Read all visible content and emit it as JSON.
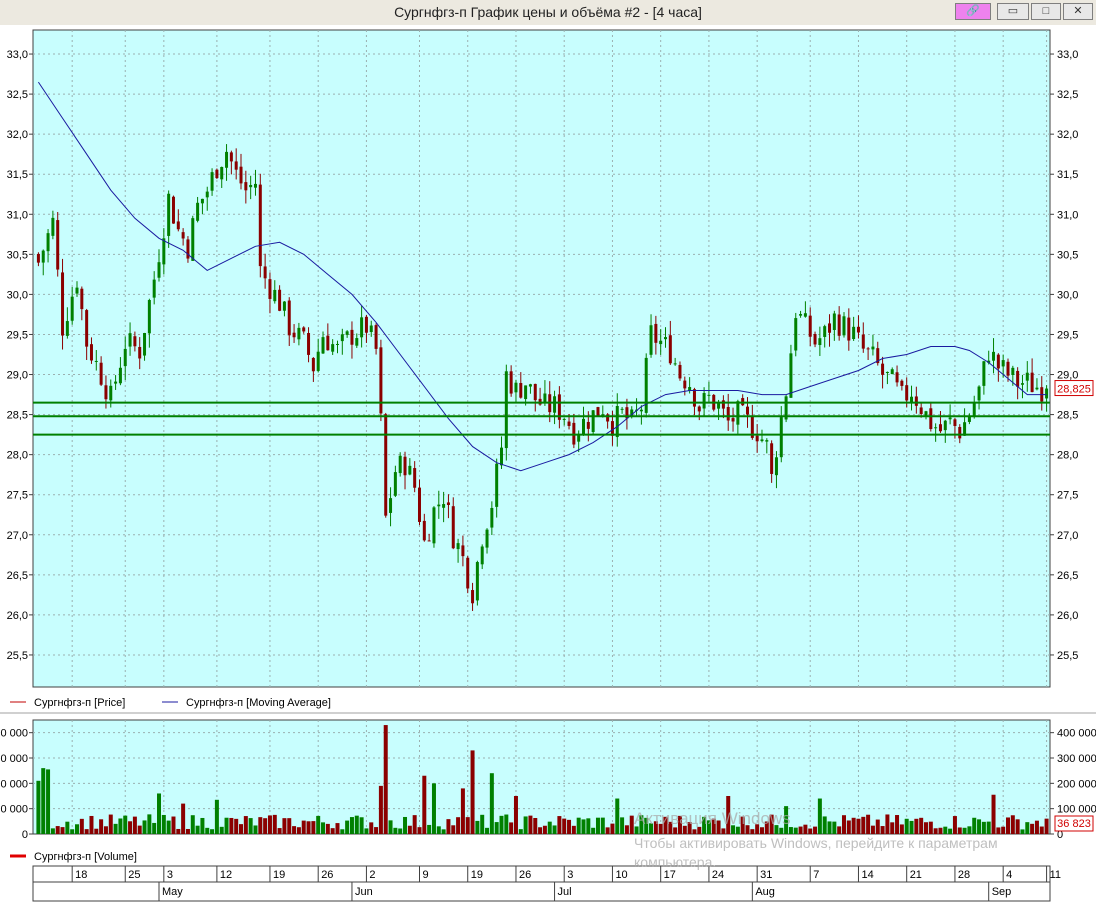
{
  "window": {
    "title": "Сургнфгз-п График цены и объёма #2 - [4 часа]",
    "buttons": {
      "link": "🔗",
      "minimize": "▭",
      "maximize": "□",
      "close": "✕"
    }
  },
  "colors": {
    "plot_bg": "#c8fefe",
    "up": "#008000",
    "down": "#8b0000",
    "ma": "#1a1aa0",
    "level": "#008000",
    "grid": "#9bb0b0",
    "price_label": "#d00000"
  },
  "legend": {
    "price": "Сургнфгз-п [Price]",
    "ma": "Сургнфгз-п [Moving Average]",
    "volume": "Сургнфгз-п [Volume]"
  },
  "last_price_label": "28,825",
  "last_volume_label": "36 823",
  "watermark": {
    "line1": "Активация Windows",
    "line2": "Чтобы активировать Windows, перейдите к параметрам компьютера."
  },
  "chart_data": [
    {
      "type": "candlestick",
      "ylim": [
        25.1,
        33.3
      ],
      "y_ticks": [
        "33,0",
        "32,5",
        "32,0",
        "31,5",
        "31,0",
        "30,5",
        "30,0",
        "29,5",
        "29,0",
        "28,5",
        "28,0",
        "27,5",
        "27,0",
        "26,5",
        "26,0",
        "25,5"
      ],
      "y_tick_values": [
        33.0,
        32.5,
        32.0,
        31.5,
        31.0,
        30.5,
        30.0,
        29.5,
        29.0,
        28.5,
        28.0,
        27.5,
        27.0,
        26.5,
        26.0,
        25.5
      ],
      "grid": true,
      "horizontal_levels": [
        28.65,
        28.48,
        28.25
      ],
      "last_price": 28.825,
      "price_anchors": [
        [
          0,
          30.4
        ],
        [
          3,
          30.9
        ],
        [
          5,
          29.6
        ],
        [
          8,
          30.2
        ],
        [
          10,
          29.4
        ],
        [
          13,
          29.0
        ],
        [
          15,
          28.7
        ],
        [
          18,
          29.4
        ],
        [
          21,
          29.3
        ],
        [
          24,
          30.2
        ],
        [
          27,
          31.2
        ],
        [
          29,
          30.8
        ],
        [
          31,
          30.6
        ],
        [
          33,
          31.1
        ],
        [
          35,
          31.3
        ],
        [
          37,
          31.6
        ],
        [
          39,
          31.8
        ],
        [
          41,
          31.5
        ],
        [
          43,
          31.3
        ],
        [
          45,
          31.4
        ],
        [
          46,
          30.3
        ],
        [
          48,
          30.1
        ],
        [
          50,
          29.9
        ],
        [
          52,
          29.6
        ],
        [
          55,
          29.4
        ],
        [
          57,
          29.1
        ],
        [
          59,
          29.5
        ],
        [
          62,
          29.3
        ],
        [
          65,
          29.5
        ],
        [
          68,
          29.6
        ],
        [
          70,
          29.3
        ],
        [
          71,
          28.4
        ],
        [
          72,
          27.2
        ],
        [
          74,
          27.8
        ],
        [
          76,
          27.9
        ],
        [
          78,
          27.6
        ],
        [
          80,
          26.9
        ],
        [
          82,
          27.3
        ],
        [
          84,
          27.5
        ],
        [
          86,
          27.0
        ],
        [
          88,
          26.7
        ],
        [
          90,
          26.3
        ],
        [
          92,
          27.0
        ],
        [
          94,
          27.4
        ],
        [
          96,
          28.1
        ],
        [
          97,
          29.0
        ],
        [
          99,
          28.8
        ],
        [
          101,
          28.9
        ],
        [
          103,
          28.7
        ],
        [
          105,
          28.6
        ],
        [
          107,
          28.6
        ],
        [
          109,
          28.5
        ],
        [
          111,
          28.3
        ],
        [
          113,
          28.4
        ],
        [
          115,
          28.5
        ],
        [
          117,
          28.6
        ],
        [
          119,
          28.4
        ],
        [
          121,
          28.5
        ],
        [
          123,
          28.4
        ],
        [
          125,
          28.6
        ],
        [
          127,
          29.5
        ],
        [
          129,
          29.4
        ],
        [
          131,
          29.3
        ],
        [
          133,
          29.0
        ],
        [
          135,
          28.9
        ],
        [
          137,
          28.6
        ],
        [
          139,
          28.7
        ],
        [
          141,
          28.6
        ],
        [
          143,
          28.4
        ],
        [
          145,
          28.5
        ],
        [
          147,
          28.4
        ],
        [
          149,
          28.3
        ],
        [
          151,
          28.1
        ],
        [
          152,
          27.7
        ],
        [
          153,
          28.1
        ],
        [
          155,
          28.8
        ],
        [
          157,
          29.8
        ],
        [
          159,
          29.6
        ],
        [
          161,
          29.4
        ],
        [
          163,
          29.5
        ],
        [
          165,
          29.7
        ],
        [
          167,
          29.6
        ],
        [
          169,
          29.5
        ],
        [
          171,
          29.3
        ],
        [
          173,
          29.2
        ],
        [
          175,
          29.0
        ],
        [
          177,
          28.9
        ],
        [
          179,
          28.7
        ],
        [
          181,
          28.8
        ],
        [
          183,
          28.6
        ],
        [
          185,
          28.4
        ],
        [
          187,
          28.3
        ],
        [
          189,
          28.4
        ],
        [
          191,
          28.3
        ],
        [
          193,
          28.5
        ],
        [
          195,
          28.8
        ],
        [
          197,
          29.3
        ],
        [
          199,
          29.1
        ],
        [
          201,
          29.0
        ],
        [
          203,
          28.9
        ],
        [
          205,
          28.9
        ],
        [
          207,
          28.85
        ],
        [
          209,
          28.825
        ]
      ],
      "ma_points": [
        [
          0,
          32.65
        ],
        [
          5,
          32.2
        ],
        [
          10,
          31.75
        ],
        [
          15,
          31.3
        ],
        [
          20,
          30.95
        ],
        [
          25,
          30.7
        ],
        [
          30,
          30.55
        ],
        [
          35,
          30.3
        ],
        [
          40,
          30.45
        ],
        [
          45,
          30.6
        ],
        [
          50,
          30.65
        ],
        [
          55,
          30.5
        ],
        [
          60,
          30.25
        ],
        [
          65,
          30.0
        ],
        [
          70,
          29.65
        ],
        [
          75,
          29.25
        ],
        [
          80,
          28.85
        ],
        [
          85,
          28.45
        ],
        [
          90,
          28.1
        ],
        [
          95,
          27.9
        ],
        [
          100,
          27.8
        ],
        [
          105,
          27.9
        ],
        [
          110,
          28.0
        ],
        [
          115,
          28.15
        ],
        [
          120,
          28.35
        ],
        [
          125,
          28.6
        ],
        [
          130,
          28.75
        ],
        [
          135,
          28.8
        ],
        [
          140,
          28.8
        ],
        [
          145,
          28.8
        ],
        [
          150,
          28.75
        ],
        [
          155,
          28.75
        ],
        [
          160,
          28.85
        ],
        [
          165,
          28.95
        ],
        [
          170,
          29.05
        ],
        [
          175,
          29.2
        ],
        [
          180,
          29.25
        ],
        [
          185,
          29.35
        ],
        [
          190,
          29.35
        ],
        [
          193,
          29.3
        ],
        [
          197,
          29.15
        ],
        [
          201,
          28.95
        ],
        [
          205,
          28.75
        ],
        [
          209,
          28.75
        ]
      ],
      "volume": {
        "ylim": [
          0,
          450000
        ],
        "y_ticks": [
          "400 000",
          "300 000",
          "200 000",
          "100 000",
          "0"
        ],
        "y_tick_values": [
          400000,
          300000,
          200000,
          100000,
          0
        ],
        "spikes": [
          [
            0,
            210000
          ],
          [
            1,
            260000
          ],
          [
            2,
            255000
          ],
          [
            72,
            430000
          ],
          [
            71,
            190000
          ],
          [
            80,
            230000
          ],
          [
            82,
            200000
          ],
          [
            90,
            330000
          ],
          [
            88,
            180000
          ],
          [
            94,
            240000
          ],
          [
            99,
            150000
          ],
          [
            120,
            140000
          ],
          [
            143,
            150000
          ],
          [
            155,
            110000
          ],
          [
            162,
            140000
          ],
          [
            198,
            155000
          ],
          [
            25,
            160000
          ],
          [
            30,
            120000
          ],
          [
            37,
            135000
          ]
        ]
      },
      "x_axis": {
        "day_ticks": [
          {
            "i": 7,
            "label": "18"
          },
          {
            "i": 18,
            "label": "25"
          },
          {
            "i": 26,
            "label": "3"
          },
          {
            "i": 37,
            "label": "12"
          },
          {
            "i": 48,
            "label": "19"
          },
          {
            "i": 58,
            "label": "26"
          },
          {
            "i": 68,
            "label": "2"
          },
          {
            "i": 79,
            "label": "9"
          },
          {
            "i": 89,
            "label": "19"
          },
          {
            "i": 99,
            "label": "26"
          },
          {
            "i": 109,
            "label": "3"
          },
          {
            "i": 119,
            "label": "10"
          },
          {
            "i": 129,
            "label": "17"
          },
          {
            "i": 139,
            "label": "24"
          },
          {
            "i": 149,
            "label": "31"
          },
          {
            "i": 160,
            "label": "7"
          },
          {
            "i": 170,
            "label": "14"
          },
          {
            "i": 180,
            "label": "21"
          },
          {
            "i": 190,
            "label": "28"
          },
          {
            "i": 200,
            "label": "4"
          },
          {
            "i": 209,
            "label": "11"
          }
        ],
        "month_ticks": [
          {
            "i": 25,
            "label": "May"
          },
          {
            "i": 65,
            "label": "Jun"
          },
          {
            "i": 107,
            "label": "Jul"
          },
          {
            "i": 148,
            "label": "Aug"
          },
          {
            "i": 197,
            "label": "Sep"
          }
        ]
      }
    }
  ]
}
